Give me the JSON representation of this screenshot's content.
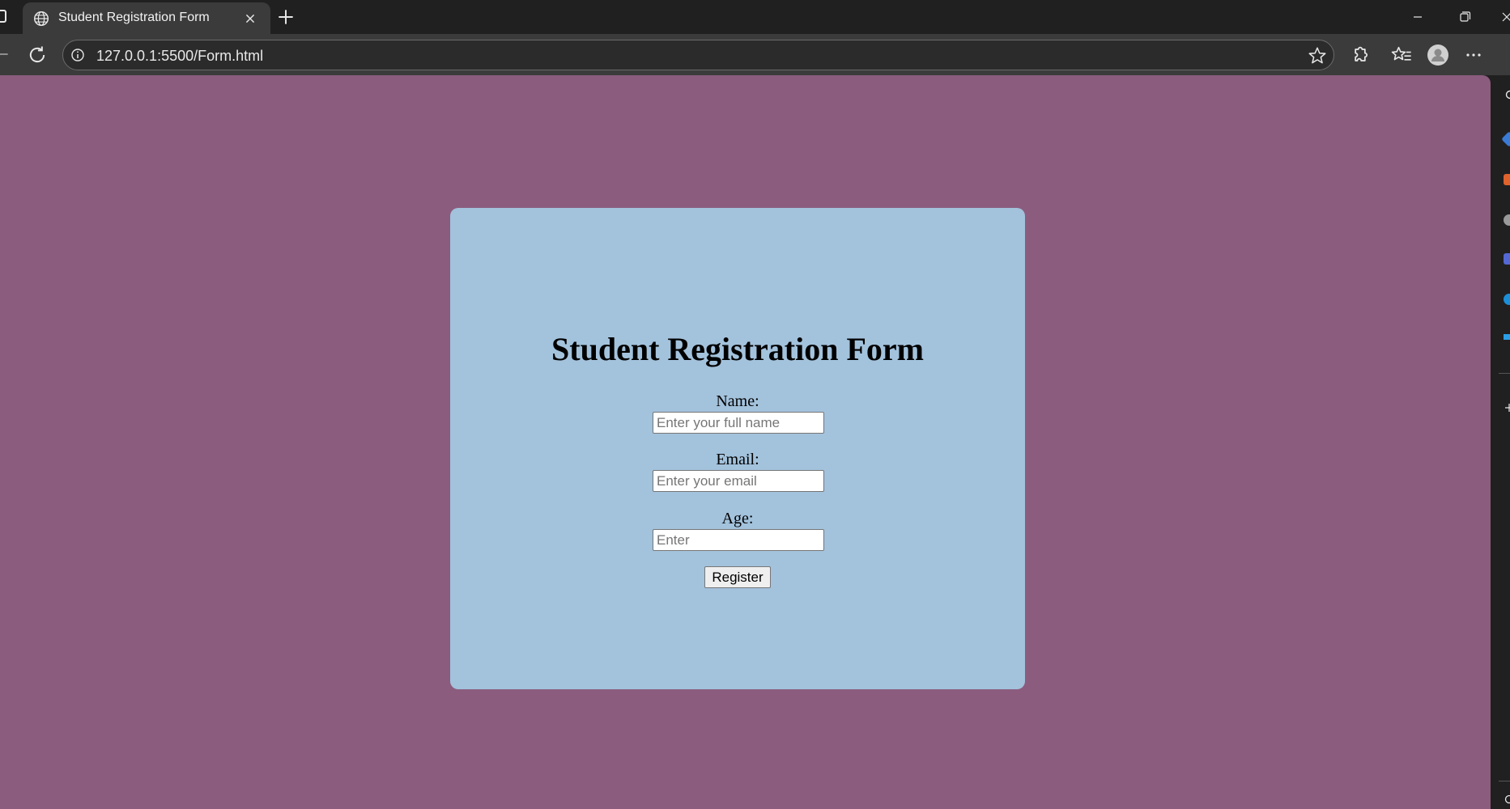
{
  "browser": {
    "tab": {
      "title": "Student Registration Form"
    },
    "address_bar": {
      "url": "127.0.0.1:5500/Form.html"
    }
  },
  "page": {
    "background_color": "#8b5c7e",
    "card_color": "#a3c2dc",
    "form": {
      "title": "Student Registration Form",
      "fields": [
        {
          "label": "Name:",
          "placeholder": "Enter your full name",
          "value": ""
        },
        {
          "label": "Email:",
          "placeholder": "Enter your email",
          "value": ""
        },
        {
          "label": "Age:",
          "placeholder": "Enter",
          "value": ""
        }
      ],
      "submit_label": "Register"
    }
  },
  "icons": {
    "tab_favicon": "globe-icon",
    "tab_close": "close-icon",
    "new_tab": "plus-icon",
    "reload": "reload-icon",
    "site_info": "info-icon",
    "favorite": "star-icon",
    "extensions": "puzzle-icon",
    "favorites_list": "favorites-icon",
    "profile": "avatar-icon",
    "more": "more-icon"
  }
}
